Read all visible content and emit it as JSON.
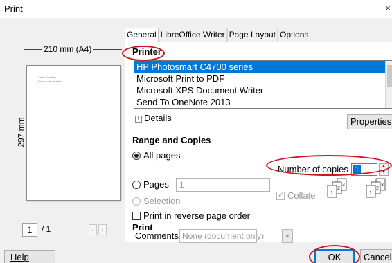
{
  "window": {
    "title": "Print",
    "close_glyph": "×"
  },
  "preview": {
    "width_label": "210 mm (A4)",
    "height_label": "297 mm",
    "page_line_1": "Table Heading",
    "page_line_2": "Para contents here",
    "current_page": "1",
    "total_pages": "/ 1",
    "prev_glyph": "‹",
    "next_glyph": "›"
  },
  "tabs": [
    {
      "label": "General",
      "active": true
    },
    {
      "label": "LibreOffice Writer"
    },
    {
      "label": "Page Layout"
    },
    {
      "label": "Options"
    }
  ],
  "printer": {
    "heading": "Printer",
    "items": [
      {
        "label": "HP Photosmart C4700 series",
        "selected": true
      },
      {
        "label": "Microsoft Print to PDF"
      },
      {
        "label": "Microsoft XPS Document Writer"
      },
      {
        "label": "Send To OneNote 2013"
      }
    ],
    "details_label": "Details",
    "properties_label": "Properties..."
  },
  "range": {
    "heading": "Range and Copies",
    "all_pages_label": "All pages",
    "pages_label": "Pages",
    "pages_value": "1",
    "selection_label": "Selection",
    "reverse_label": "Print in reverse page order",
    "copies_label": "Number of copies",
    "copies_value": "1",
    "collate_label": "Collate"
  },
  "print_section": {
    "heading": "Print",
    "comments_label": "Comments",
    "comments_value": "None (document only)"
  },
  "buttons": {
    "help": "Help",
    "ok": "OK",
    "cancel": "Cancel"
  },
  "colors": {
    "selection": "#0078d7",
    "annotation": "#d0141e",
    "dialog_bg": "#f0f0f0"
  },
  "icons": [
    "close-icon",
    "expand-plus-icon",
    "spin-up-icon",
    "spin-down-icon",
    "dropdown-arrow-icon",
    "collate-pages-icon"
  ]
}
